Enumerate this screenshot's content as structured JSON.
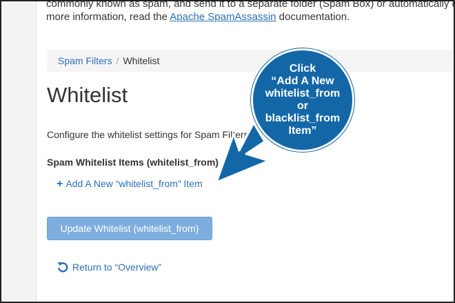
{
  "intro": {
    "line1": "commonly known as spam, and send it to a separate folder (Spam Box) or automatically de",
    "line2_prefix": "more information, read the ",
    "line2_link": "Apache SpamAssassin",
    "line2_suffix": " documentation."
  },
  "breadcrumb": {
    "parent": "Spam Filters",
    "separator": "/",
    "current": "Whitelist"
  },
  "page": {
    "title": "Whitelist",
    "description": "Configure the whitelist settings for Spam Filters",
    "section_label": "Spam Whitelist Items (whitelist_from)"
  },
  "actions": {
    "add_label": "Add A New “whitelist_from” Item",
    "update_label": "Update Whitelist (whitelist_from)",
    "return_label": "Return to “Overview”"
  },
  "callout": {
    "text": "Click\n“Add A New\nwhitelist_from\nor\nblacklist_from\nItem”",
    "color": "#1467a6"
  },
  "colors": {
    "link": "#2c6fb7",
    "button": "#7eaede"
  },
  "icons": {
    "add": "plus-icon",
    "return": "undo-arrow-icon"
  }
}
